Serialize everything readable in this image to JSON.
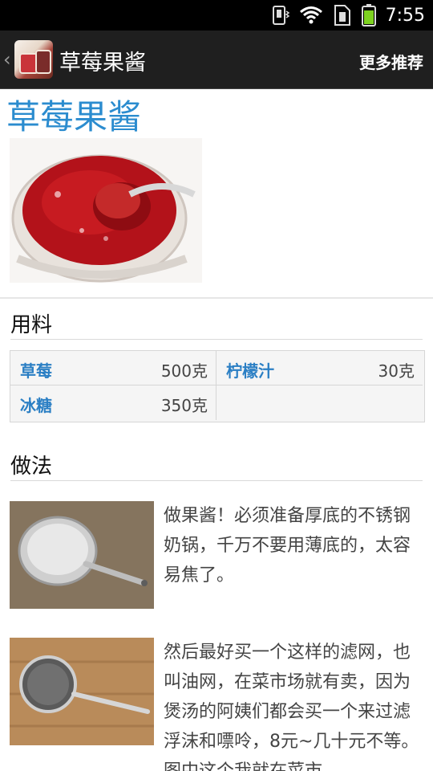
{
  "status_bar": {
    "time": "7:55",
    "icons": [
      "vibrate-icon",
      "wifi-icon",
      "sim-icon",
      "battery-icon"
    ]
  },
  "action_bar": {
    "title": "草莓果酱",
    "more_label": "更多推荐"
  },
  "recipe": {
    "title": "草莓果酱",
    "ingredients_heading": "用料",
    "ingredients": [
      {
        "name": "草莓",
        "amount": "500克"
      },
      {
        "name": "柠檬汁",
        "amount": "30克"
      },
      {
        "name": "冰糖",
        "amount": "350克"
      },
      {
        "name": "",
        "amount": ""
      }
    ],
    "method_heading": "做法",
    "steps": [
      {
        "text": "做果酱！必须准备厚底的不锈钢奶锅，千万不要用薄底的，太容易焦了。"
      },
      {
        "text": "然后最好买一个这样的滤网，也叫油网，在菜市场就有卖，因为煲汤的阿姨们都会买一个来过滤浮沫和嘌呤，8元~几十元不等。图中这个我就在菜市"
      }
    ]
  },
  "colors": {
    "accent_blue": "#2b8ccf",
    "ingredient_blue": "#2b7fc4",
    "actionbar": "#1f1f1f"
  }
}
